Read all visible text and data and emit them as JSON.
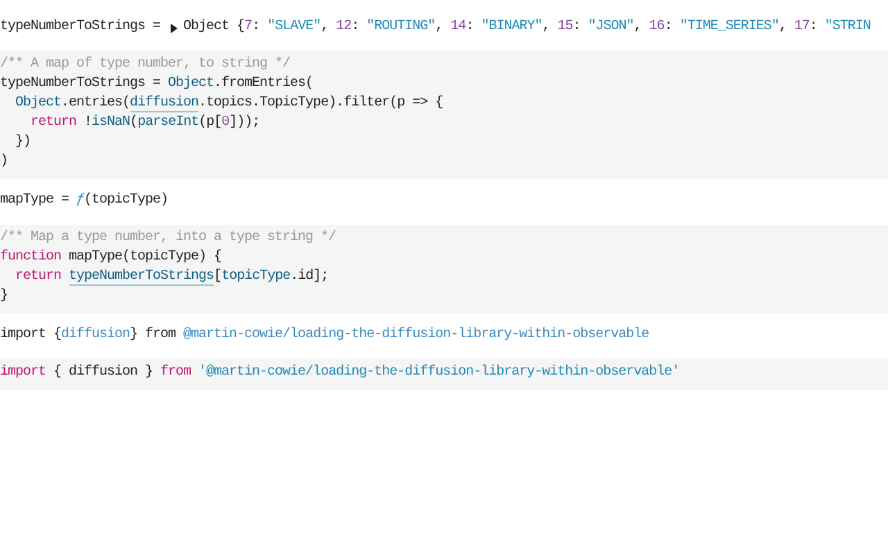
{
  "cells": [
    {
      "kind": "output",
      "collapsed": true,
      "label": [
        {
          "plain": "typeNumberToStrings = "
        }
      ],
      "value": [
        {
          "plain": "Object {"
        },
        {
          "number": "7"
        },
        {
          "plain": ": "
        },
        {
          "string": "\"SLAVE\""
        },
        {
          "plain": ", "
        },
        {
          "number": "12"
        },
        {
          "plain": ": "
        },
        {
          "string": "\"ROUTING\""
        },
        {
          "plain": ", "
        },
        {
          "number": "14"
        },
        {
          "plain": ": "
        },
        {
          "string": "\"BINARY\""
        },
        {
          "plain": ", "
        },
        {
          "number": "15"
        },
        {
          "plain": ": "
        },
        {
          "string": "\"JSON\""
        },
        {
          "plain": ", "
        },
        {
          "number": "16"
        },
        {
          "plain": ": "
        },
        {
          "string": "\"TIME_SERIES\""
        },
        {
          "plain": ", "
        },
        {
          "number": "17"
        },
        {
          "plain": ": "
        },
        {
          "string": "\"STRIN"
        }
      ]
    },
    {
      "kind": "source",
      "lines": [
        [
          {
            "comment": "/** A map of type number, to string */"
          }
        ],
        [
          {
            "plain": "typeNumberToStrings = "
          },
          {
            "builtin": "Object"
          },
          {
            "plain": ".fromEntries("
          }
        ],
        [
          {
            "builtin": "  Object"
          },
          {
            "plain": ".entries("
          },
          {
            "ref": "diffusion"
          },
          {
            "plain": ".topics.TopicType).filter(p => {"
          }
        ],
        [
          {
            "keyword": "    return"
          },
          {
            "plain": " !"
          },
          {
            "builtin": "isNaN"
          },
          {
            "plain": "("
          },
          {
            "builtin": "parseInt"
          },
          {
            "plain": "(p["
          },
          {
            "number": "0"
          },
          {
            "plain": "]));"
          }
        ],
        [
          {
            "plain": "  })"
          }
        ],
        [
          {
            "plain": ")"
          }
        ]
      ]
    },
    {
      "kind": "output",
      "label": [
        {
          "plain": "mapType = "
        }
      ],
      "value": [
        {
          "fn": "ƒ"
        },
        {
          "plain": "(topicType)"
        }
      ]
    },
    {
      "kind": "source",
      "lines": [
        [
          {
            "comment": "/** Map a type number, into a type string */"
          }
        ],
        [
          {
            "keyword": "function"
          },
          {
            "plain": " mapType(topicType) {"
          }
        ],
        [
          {
            "keyword": "  return "
          },
          {
            "ref": "typeNumberToStrings"
          },
          {
            "plain": "["
          },
          {
            "builtin": "topicType"
          },
          {
            "plain": ".id];"
          }
        ],
        [
          {
            "plain": "}"
          }
        ]
      ]
    },
    {
      "kind": "output",
      "label": [
        {
          "plain": "import {"
        },
        {
          "link": "diffusion"
        },
        {
          "plain": "} from "
        }
      ],
      "value": [
        {
          "link": "@martin-cowie/loading-the-diffusion-library-within-observable"
        }
      ]
    },
    {
      "kind": "source",
      "lines": [
        [
          {
            "keyword": "import"
          },
          {
            "plain": " { diffusion } "
          },
          {
            "keyword": "from "
          },
          {
            "string": "'@martin-cowie/loading-the-diffusion-library-within-observable'"
          }
        ]
      ]
    }
  ]
}
